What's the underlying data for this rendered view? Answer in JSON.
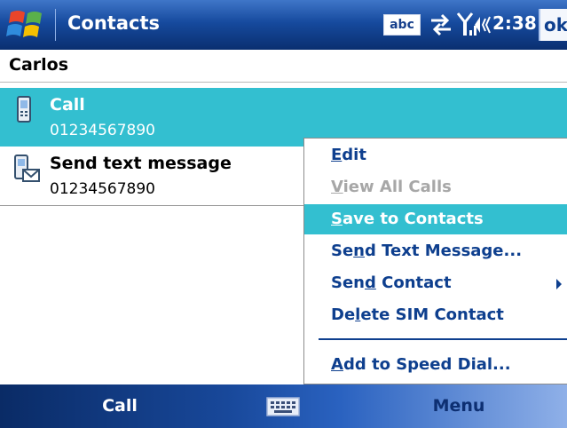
{
  "titlebar": {
    "app_title": "Contacts",
    "input_mode": "abc",
    "time": "2:38",
    "ok_label": "ok",
    "icons": [
      "windows-start-icon",
      "abc-input-icon",
      "connectivity-icon",
      "signal-icon",
      "volume-icon"
    ]
  },
  "contact": {
    "name": "Carlos"
  },
  "list": [
    {
      "title": "Call",
      "subtitle": "01234567890",
      "icon": "mobile-phone-icon",
      "selected": true
    },
    {
      "title": "Send text message",
      "subtitle": "01234567890",
      "icon": "sms-message-icon",
      "selected": false
    }
  ],
  "menu": {
    "items": [
      {
        "label": "Edit",
        "accel": "E",
        "enabled": true,
        "highlighted": false
      },
      {
        "label": "View All Calls",
        "accel": "V",
        "enabled": false,
        "highlighted": false
      },
      {
        "label": "Save to Contacts",
        "accel": "S",
        "enabled": true,
        "highlighted": true
      },
      {
        "label": "Send Text Message...",
        "accel": "n",
        "enabled": true,
        "highlighted": false
      },
      {
        "label": "Send Contact",
        "accel": "d",
        "enabled": true,
        "highlighted": false,
        "submenu": true
      },
      {
        "label": "Delete SIM Contact",
        "accel": "l",
        "enabled": true,
        "highlighted": false
      },
      {
        "label": "Add to Speed Dial...",
        "accel": "A",
        "enabled": true,
        "highlighted": false
      }
    ]
  },
  "softkeys": {
    "left": "Call",
    "right": "Menu"
  },
  "colors": {
    "selection": "#33bfd0",
    "menu_text": "#0e3f8e",
    "disabled_text": "#a7a7a7",
    "title_bar": "#164a9e"
  }
}
